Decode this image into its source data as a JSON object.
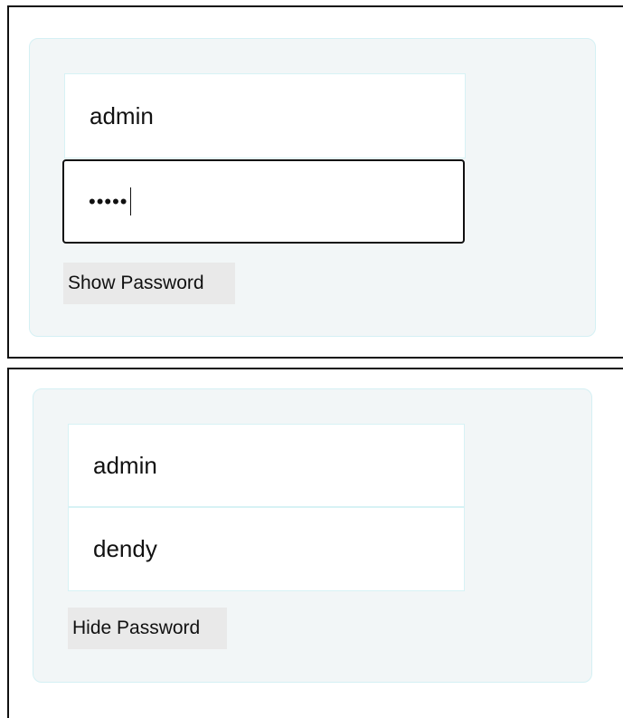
{
  "panels": [
    {
      "username": "admin",
      "password_display": "•••••",
      "password_masked": true,
      "toggle_label": "Show Password"
    },
    {
      "username": "admin",
      "password_display": "dendy",
      "password_masked": false,
      "toggle_label": "Hide Password"
    }
  ],
  "colors": {
    "card_background": "#f2f6f7",
    "card_border": "#d5f0f4",
    "field_border": "#d7f2f5",
    "focused_border": "#111111",
    "button_background": "#e9e9e9"
  }
}
